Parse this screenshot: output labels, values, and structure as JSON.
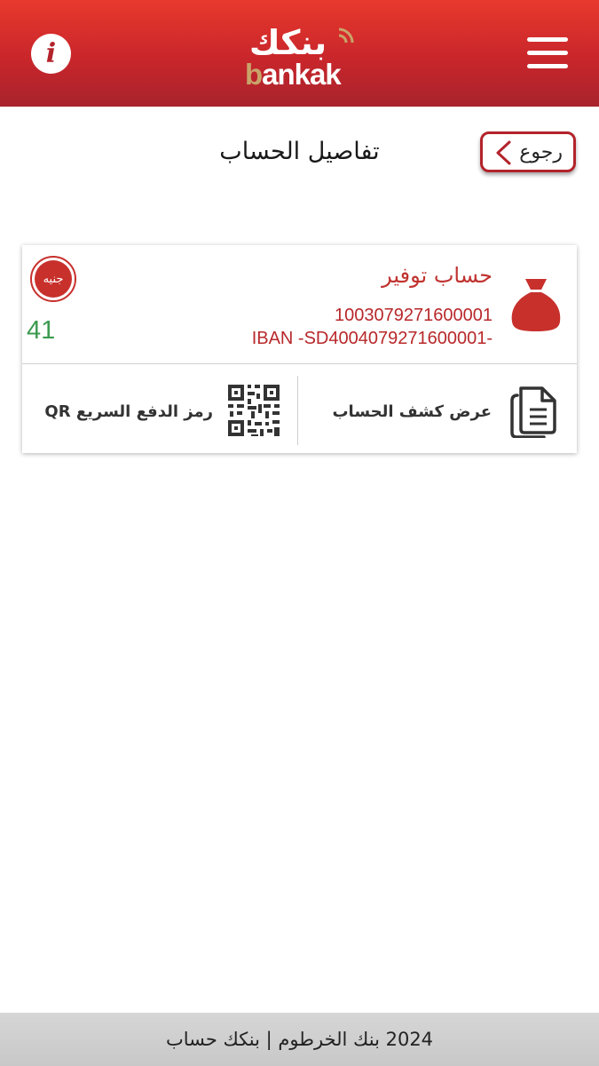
{
  "header": {
    "logo_ar": "بنكك",
    "logo_en_first": "b",
    "logo_en_rest": "ankak",
    "info_icon": "info-icon",
    "menu_icon": "hamburger-menu-icon"
  },
  "nav": {
    "back_label": "رجوع",
    "page_title": "تفاصيل الحساب"
  },
  "account": {
    "name": "حساب توفير",
    "number": "1003079271600001",
    "iban": "IBAN -SD4004079271600001-",
    "currency": "جنيه",
    "balance": "41",
    "icon": "money-bag-icon"
  },
  "actions": {
    "statement_label": "عرض كشف الحساب",
    "statement_icon": "documents-icon",
    "qr_label": "رمز الدفع السريع QR",
    "qr_icon": "qr-code-icon"
  },
  "footer": {
    "text": "2024 بنك الخرطوم | بنكك حساب"
  },
  "colors": {
    "brand_red": "#c9262b",
    "accent_gold": "#c9a46a",
    "balance_green": "#3c9a4f"
  }
}
